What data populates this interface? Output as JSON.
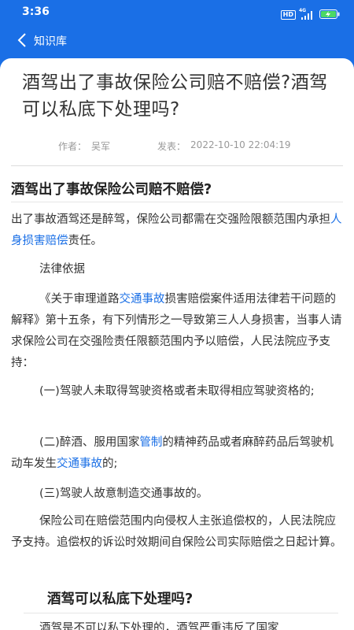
{
  "status": {
    "time": "3:36",
    "hd": "HD",
    "network": "4G"
  },
  "nav": {
    "title": "知识库"
  },
  "article": {
    "title": "酒驾出了事故保险公司赔不赔偿?酒驾可以私底下处理吗?",
    "author_label": "作者：",
    "author": "吴军",
    "date_label": "发表：",
    "date": "2022-10-10 22:04:19",
    "section1": "酒驾出了事故保险公司赔不赔偿?",
    "p1_a": "出了事故酒驾还是醉驾，保险公司都需在交强险限额范围内承担",
    "p1_link": "人身损害赔偿",
    "p1_b": "责任。",
    "p2": "法律依据",
    "p3_a": "《关于审理道路",
    "p3_link": "交通事故",
    "p3_b": "损害赔偿案件适用法律若干问题的解释》第十五条，有下列情形之一导致第三人人身损害，当事人请求保险公司在交强险责任限额范围内予以赔偿，人民法院应予支持：",
    "p4": "(一)驾驶人未取得驾驶资格或者未取得相应驾驶资格的;",
    "p5_a": "(二)醉酒、服用国家",
    "p5_link1": "管制",
    "p5_b": "的精神药品或者麻醉药品后驾驶机动车发生",
    "p5_link2": "交通事故",
    "p5_c": "的;",
    "p6": "(三)驾驶人故意制造交通事故的。",
    "p7": "保险公司在赔偿范围内向侵权人主张追偿权的，人民法院应予支持。追偿权的诉讼时效期间自保险公司实际赔偿之日起计算。",
    "section2": "酒驾可以私底下处理吗?",
    "p8": "酒驾是不可以私下处理的，酒驾严重违反了国家"
  }
}
